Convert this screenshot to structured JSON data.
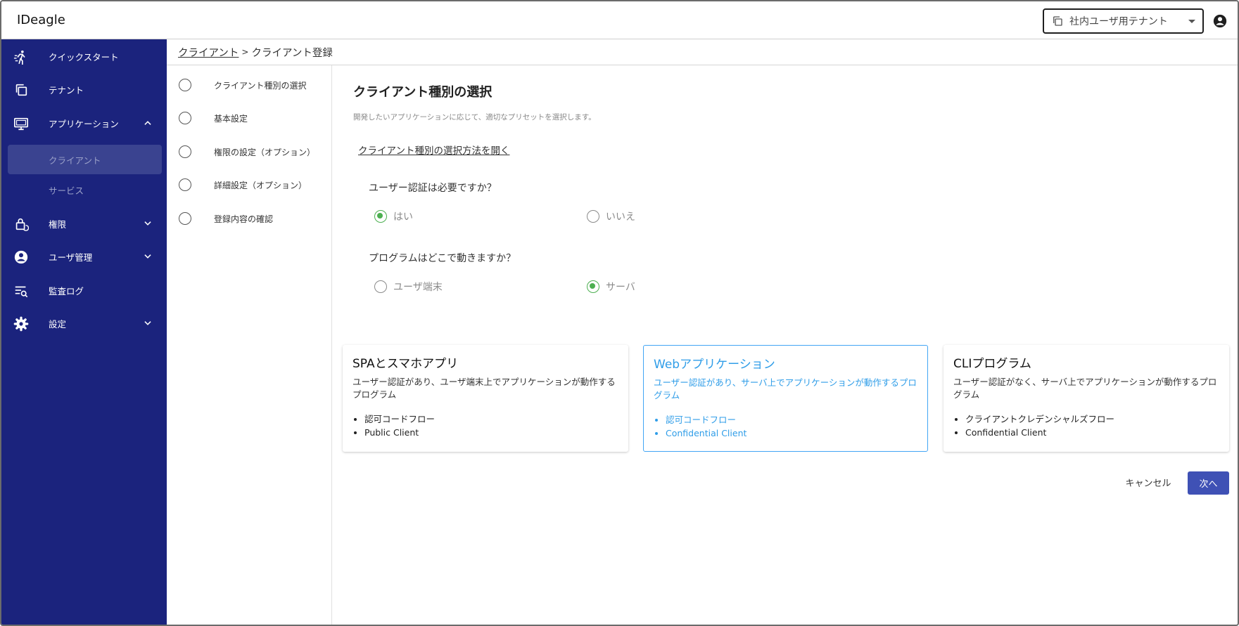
{
  "header": {
    "app_title": "IDeagle",
    "tenant_select_value": "社内ユーザ用テナント"
  },
  "sidebar": {
    "items": [
      {
        "label": "クイックスタート",
        "icon": "run-icon"
      },
      {
        "label": "テナント",
        "icon": "copy-icon"
      },
      {
        "label": "アプリケーション",
        "icon": "monitor-icon",
        "expanded": true
      },
      {
        "label": "クライアント",
        "active": true
      },
      {
        "label": "サービス"
      },
      {
        "label": "権限",
        "icon": "lock-reset-icon"
      },
      {
        "label": "ユーザ管理",
        "icon": "account-circle-icon"
      },
      {
        "label": "監査ログ",
        "icon": "list-search-icon"
      },
      {
        "label": "設定",
        "icon": "gear-icon"
      }
    ]
  },
  "breadcrumb": {
    "parent": "クライアント",
    "separator": ">",
    "current": "クライアント登録"
  },
  "steps": [
    "クライアント種別の選択",
    "基本設定",
    "権限の設定（オプション）",
    "詳細設定（オプション）",
    "登録内容の確認"
  ],
  "main": {
    "title": "クライアント種別の選択",
    "description": "開発したいアプリケーションに応じて、適切なプリセットを選択します。",
    "guide_link": "クライアント種別の選択方法を開く",
    "q1": {
      "label": "ユーザー認証は必要ですか？",
      "options": [
        "はい",
        "いいえ"
      ],
      "selected": "はい"
    },
    "q2": {
      "label": "プログラムはどこで動きますか？",
      "options": [
        "ユーザ端末",
        "サーバ"
      ],
      "selected": "サーバ"
    },
    "cards": [
      {
        "title": "SPAとスマホアプリ",
        "description": "ユーザー認証があり、ユーザ端末上でアプリケーションが動作するプログラム",
        "bullets": [
          "認可コードフロー",
          "Public Client"
        ]
      },
      {
        "title": "Webアプリケーション",
        "description": "ユーザー認証があり、サーバ上でアプリケーションが動作するプログラム",
        "bullets": [
          "認可コードフロー",
          "Confidential Client"
        ],
        "selected": true
      },
      {
        "title": "CLIプログラム",
        "description": "ユーザー認証がなく、サーバ上でアプリケーションが動作するプログラム",
        "bullets": [
          "クライアントクレデンシャルズフロー",
          "Confidential Client"
        ]
      }
    ],
    "cancel_label": "キャンセル",
    "next_label": "次へ"
  },
  "colors": {
    "sidebar_bg": "#1b237d",
    "sidebar_active": "#3a4390",
    "primary_button": "#3f51b5",
    "selected_card": "#42a5f5",
    "radio_checked": "#4caf50"
  }
}
